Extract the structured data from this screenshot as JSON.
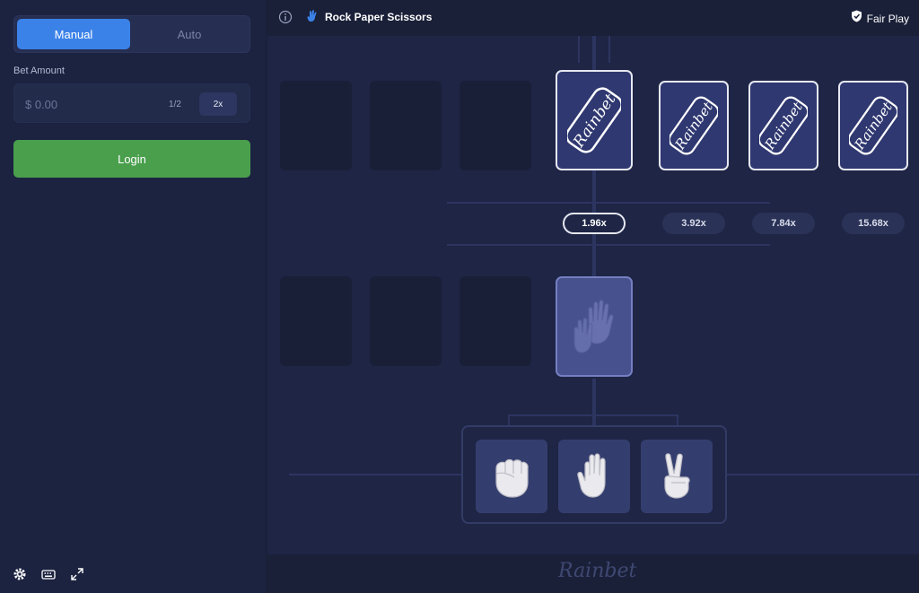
{
  "sidebar": {
    "mode_manual": "Manual",
    "mode_auto": "Auto",
    "bet_label": "Bet Amount",
    "bet_placeholder": "$ 0.00",
    "half_label": "1/2",
    "double_label": "2x",
    "login_label": "Login"
  },
  "header": {
    "title": "Rock Paper Scissors",
    "fair_play": "Fair Play"
  },
  "game": {
    "card_brand": "Rainbet",
    "multipliers": [
      "1.96x",
      "3.92x",
      "7.84x",
      "15.68x"
    ],
    "active_multiplier_index": 0,
    "choices": [
      "rock",
      "paper",
      "scissors"
    ]
  },
  "footer": {
    "brand": "Rainbet"
  },
  "colors": {
    "accent_blue": "#3b82e8",
    "login_green": "#4a9f4d",
    "background": "#1a2038"
  }
}
